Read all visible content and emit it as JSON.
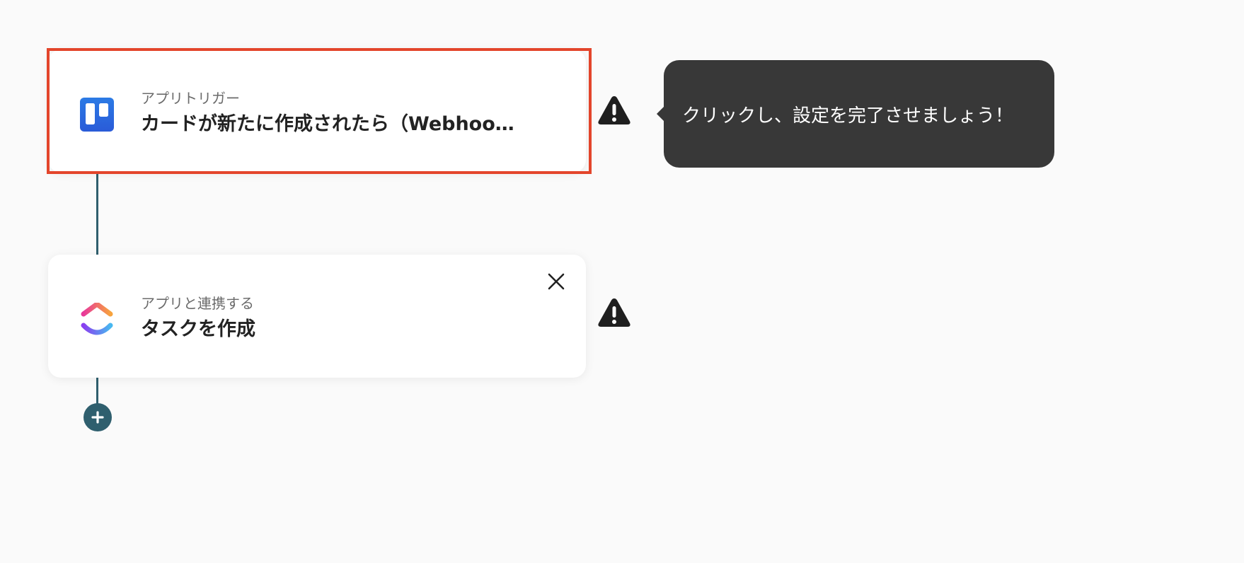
{
  "flow": {
    "steps": [
      {
        "subtitle": "アプリトリガー",
        "title": "カードが新たに作成されたら（Webhook）",
        "icon": "trello-icon",
        "status_icon": "warning-icon",
        "highlighted": true
      },
      {
        "subtitle": "アプリと連携する",
        "title": "タスクを作成",
        "icon": "clickup-icon",
        "status_icon": "warning-icon"
      }
    ],
    "tooltip": "クリックし、設定を完了させましょう！",
    "add_icon": "plus-icon",
    "close_icon": "close-icon"
  },
  "colors": {
    "highlight": "#e3452b",
    "connector": "#2f5f6e",
    "tooltip_bg": "#383838",
    "background": "#fafafa",
    "trello_blue": "#2f6fe0"
  }
}
